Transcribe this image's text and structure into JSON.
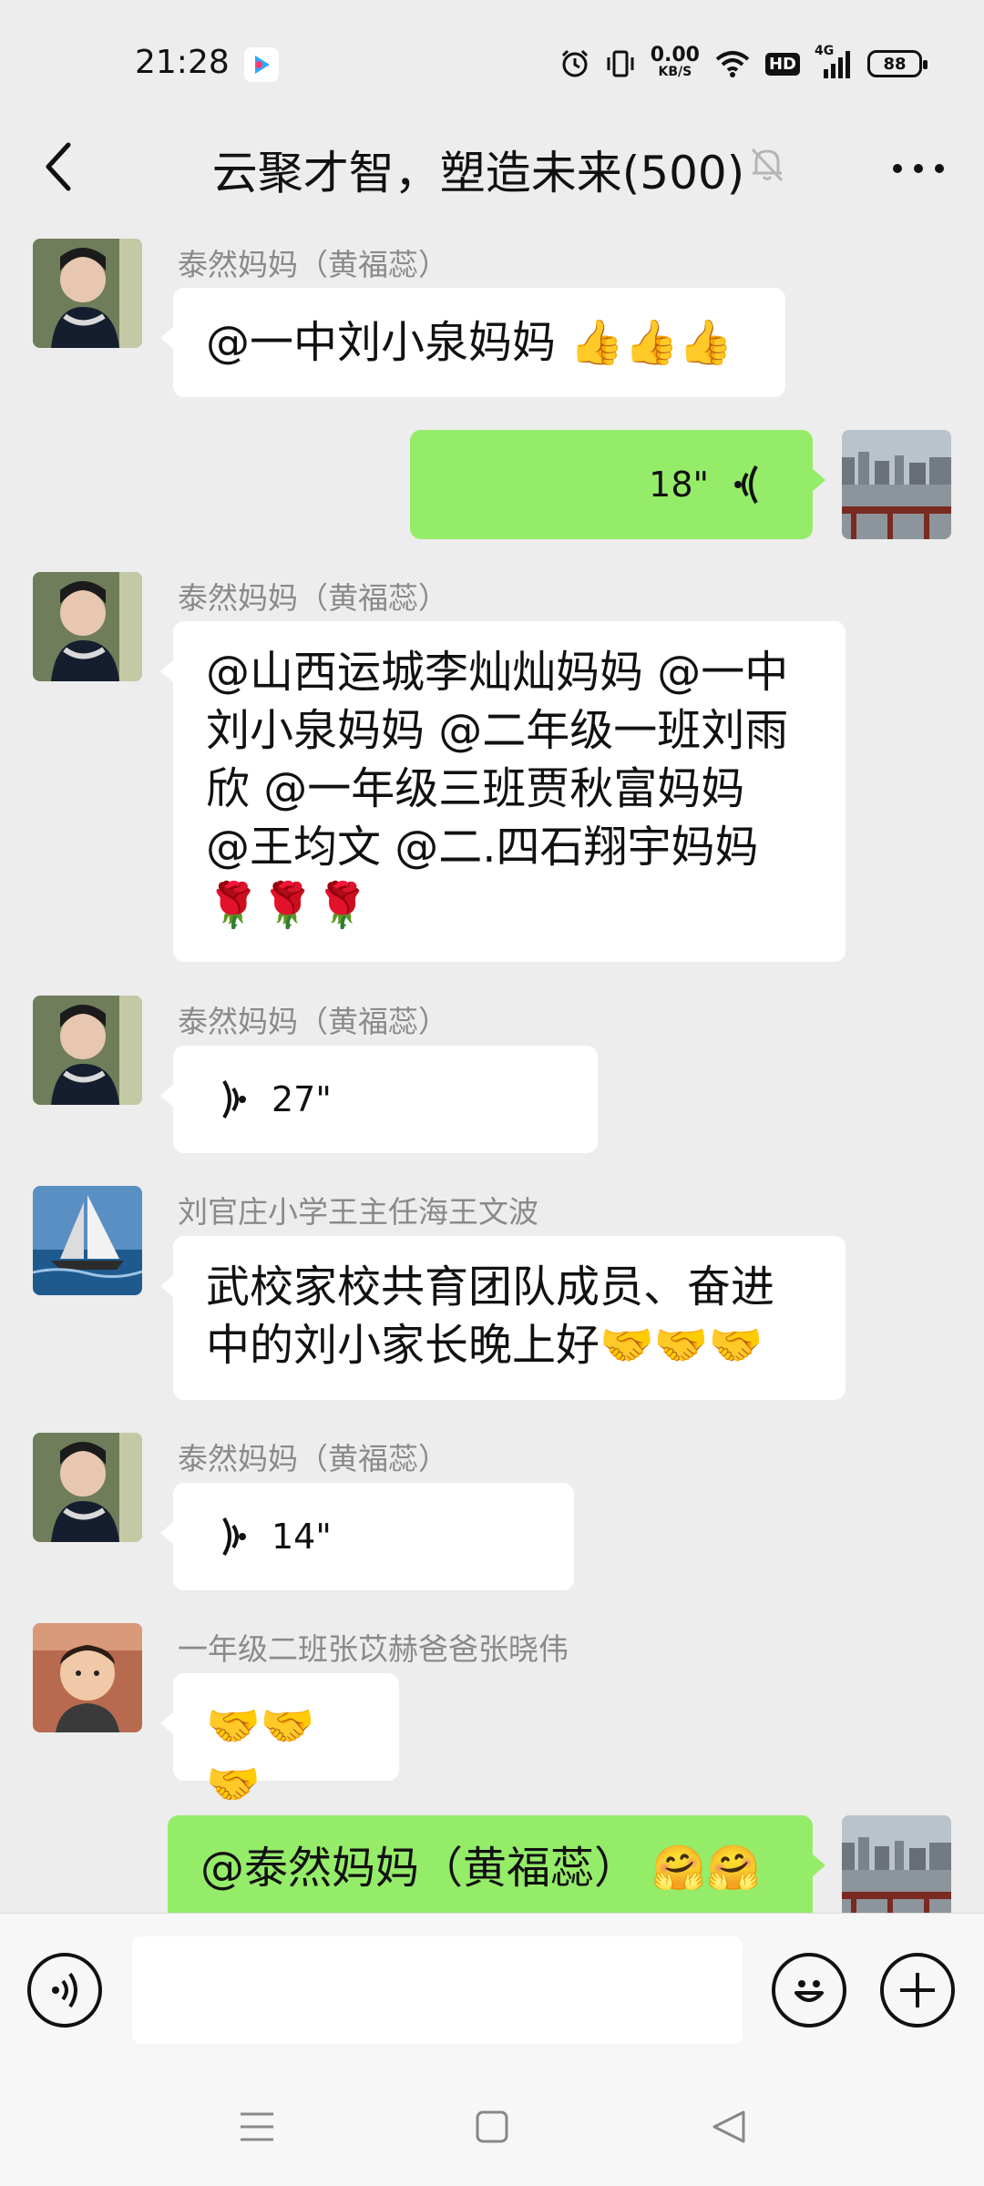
{
  "status_bar": {
    "time": "21:28",
    "app_icon": "youku-icon",
    "net_speed_value": "0.00",
    "net_speed_unit": "KB/S",
    "hd_label": "HD",
    "network_label": "4G",
    "battery_level": "88",
    "icons": [
      "alarm-icon",
      "vibrate-icon",
      "wifi-icon",
      "signal-icon",
      "battery-icon"
    ]
  },
  "header": {
    "title": "云聚才智，塑造未来(500)",
    "back_icon": "chevron-left-icon",
    "mute_icon": "bell-off-icon",
    "more_icon": "more-dots-icon"
  },
  "messages": [
    {
      "side": "left",
      "sender": "泰然妈妈（黄福蕊）",
      "type": "text",
      "text": "@一中刘小泉妈妈 👍👍👍"
    },
    {
      "side": "right",
      "type": "voice",
      "duration": "18\""
    },
    {
      "side": "left",
      "sender": "泰然妈妈（黄福蕊）",
      "type": "text",
      "lines": [
        "@山西运城李灿灿妈妈 @一中",
        "刘小泉妈妈 @二年级一班刘雨",
        "欣 @一年级三班贾秋富妈妈",
        "@王均文 @二.四石翔宇妈妈",
        "🌹🌹🌹"
      ]
    },
    {
      "side": "left",
      "sender": "泰然妈妈（黄福蕊）",
      "type": "voice",
      "duration": "27\""
    },
    {
      "side": "left",
      "sender": "刘官庄小学王主任海王文波",
      "type": "text",
      "lines": [
        "武校家校共育团队成员、奋进",
        "中的刘小家长晚上好🤝🤝🤝"
      ]
    },
    {
      "side": "left",
      "sender": "泰然妈妈（黄福蕊）",
      "type": "voice",
      "duration": "14\""
    },
    {
      "side": "left",
      "sender": "一年级二班张苡赫爸爸张晓伟",
      "type": "text",
      "text": "🤝🤝🤝"
    },
    {
      "side": "right",
      "type": "text",
      "text": "@泰然妈妈（黄福蕊） 🤗🤗"
    }
  ],
  "input_bar": {
    "voice_icon": "voice-mode-icon",
    "emoji_icon": "emoji-icon",
    "plus_icon": "plus-icon",
    "input_value": ""
  },
  "nav_bar": {
    "icons": [
      "menu-icon",
      "home-icon",
      "back-triangle-icon"
    ]
  }
}
